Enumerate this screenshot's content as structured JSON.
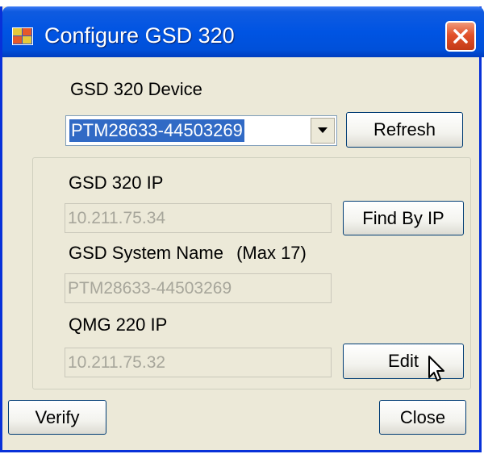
{
  "window": {
    "title": "Configure GSD 320"
  },
  "device": {
    "label": "GSD 320 Device",
    "selected": "PTM28633-44503269",
    "refresh_label": "Refresh"
  },
  "ip": {
    "label": "GSD 320 IP",
    "value": "10.211.75.34",
    "find_label": "Find By IP"
  },
  "system_name": {
    "label": "GSD System Name",
    "hint": "(Max 17)",
    "value": "PTM28633-44503269"
  },
  "qmg": {
    "label": "QMG 220 IP",
    "value": "10.211.75.32",
    "edit_label": "Edit"
  },
  "footer": {
    "verify_label": "Verify",
    "close_label": "Close"
  },
  "icons": {
    "app": "app-icon",
    "close": "close-x-icon",
    "dropdown": "chevron-down-icon",
    "pointer": "mouse-pointer-icon"
  },
  "colors": {
    "titlebar": "#0054e3",
    "window_bg": "#ece9d8",
    "close_btn": "#e2512a",
    "selection": "#316ac5",
    "disabled_text": "#a7a69b"
  }
}
